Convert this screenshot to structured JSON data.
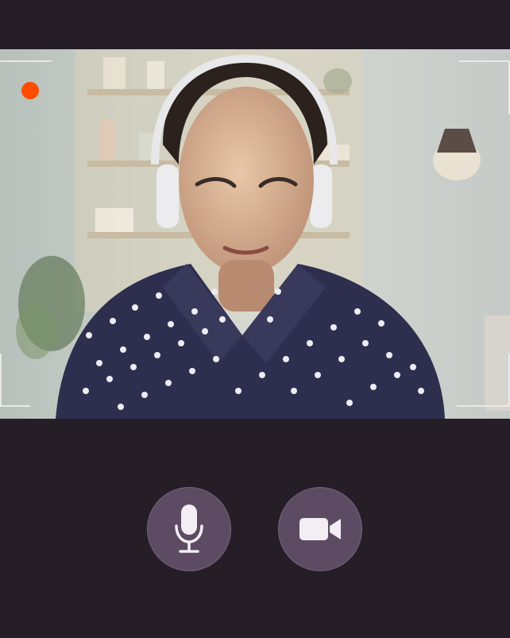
{
  "call": {
    "participant_feed": "participant-video",
    "recording_indicator_color": "#ff4d00"
  },
  "controls": {
    "microphone": {
      "icon": "microphone-icon",
      "color": "#f2eef3"
    },
    "camera": {
      "icon": "video-camera-icon",
      "color": "#f2eef3"
    }
  },
  "theme": {
    "background": "#251e27",
    "button_background": "#5d4b64",
    "frame_color": "#e9e9ea"
  }
}
